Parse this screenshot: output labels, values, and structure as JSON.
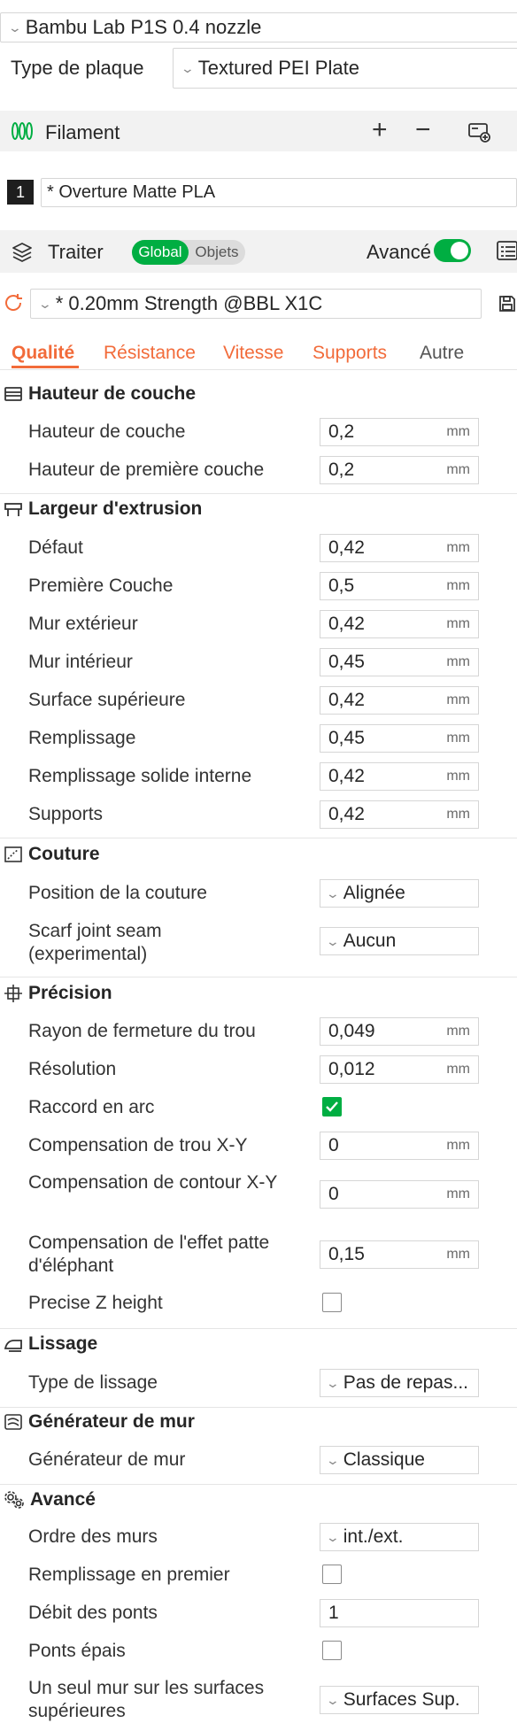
{
  "printer": {
    "name": "Bambu Lab P1S 0.4 nozzle"
  },
  "plate": {
    "label": "Type de plaque",
    "value": "Textured PEI Plate"
  },
  "filament": {
    "header": "Filament",
    "slot_number": "1",
    "slot_value": "* Overture Matte PLA"
  },
  "process": {
    "header": "Traiter",
    "toggle_global": "Global",
    "toggle_objects": "Objets",
    "advanced_label": "Avancé",
    "preset": "* 0.20mm Strength @BBL X1C"
  },
  "tabs": [
    "Qualité",
    "Résistance",
    "Vitesse",
    "Supports",
    "Autre"
  ],
  "colors": {
    "accent_orange": "#f26b3a",
    "brand_green": "#00ae42"
  },
  "sections": {
    "layer_height": {
      "title": "Hauteur de couche",
      "rows": [
        {
          "label": "Hauteur de couche",
          "value": "0,2",
          "unit": "mm"
        },
        {
          "label": "Hauteur de première couche",
          "value": "0,2",
          "unit": "mm"
        }
      ]
    },
    "line_width": {
      "title": "Largeur d'extrusion",
      "rows": [
        {
          "label": "Défaut",
          "value": "0,42",
          "unit": "mm"
        },
        {
          "label": "Première Couche",
          "value": "0,5",
          "unit": "mm"
        },
        {
          "label": "Mur extérieur",
          "value": "0,42",
          "unit": "mm"
        },
        {
          "label": "Mur intérieur",
          "value": "0,45",
          "unit": "mm"
        },
        {
          "label": "Surface supérieure",
          "value": "0,42",
          "unit": "mm"
        },
        {
          "label": "Remplissage",
          "value": "0,45",
          "unit": "mm"
        },
        {
          "label": "Remplissage solide interne",
          "value": "0,42",
          "unit": "mm"
        },
        {
          "label": "Supports",
          "value": "0,42",
          "unit": "mm"
        }
      ]
    },
    "seam": {
      "title": "Couture",
      "rows": [
        {
          "label": "Position de la couture",
          "value": "Alignée"
        },
        {
          "label": "Scarf joint seam (experimental)",
          "value": "Aucun"
        }
      ]
    },
    "precision": {
      "title": "Précision",
      "rows": [
        {
          "label": "Rayon de fermeture du trou",
          "value": "0,049",
          "unit": "mm"
        },
        {
          "label": "Résolution",
          "value": "0,012",
          "unit": "mm"
        },
        {
          "label": "Raccord en arc",
          "checked": true
        },
        {
          "label": "Compensation de trou X-Y",
          "value": "0",
          "unit": "mm"
        },
        {
          "label": "Compensation de contour X-Y",
          "value": "0",
          "unit": "mm"
        },
        {
          "label": "Compensation de l'effet patte d'éléphant",
          "value": "0,15",
          "unit": "mm"
        },
        {
          "label": "Precise Z height",
          "checked": false
        }
      ]
    },
    "ironing": {
      "title": "Lissage",
      "rows": [
        {
          "label": "Type de lissage",
          "value": "Pas de repas..."
        }
      ]
    },
    "wall_generator": {
      "title": "Générateur de mur",
      "rows": [
        {
          "label": "Générateur de mur",
          "value": "Classique"
        }
      ]
    },
    "advanced": {
      "title": "Avancé",
      "rows": [
        {
          "label": "Ordre des murs",
          "value": "int./ext."
        },
        {
          "label": "Remplissage en premier",
          "checked": false
        },
        {
          "label": "Débit des ponts",
          "value": "1"
        },
        {
          "label": "Ponts épais",
          "checked": false
        },
        {
          "label": "Un seul mur sur les surfaces supérieures",
          "value": "Surfaces Sup."
        }
      ]
    }
  }
}
